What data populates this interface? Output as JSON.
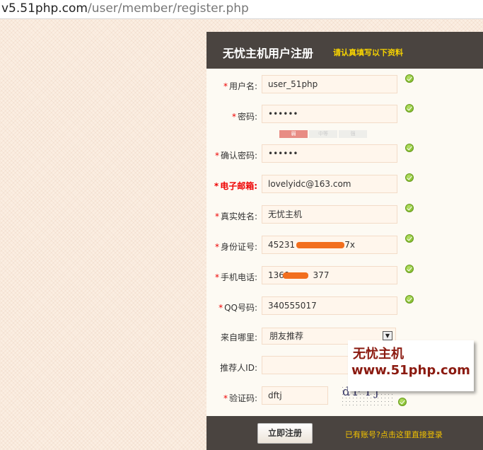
{
  "browser": {
    "url_host": "v5.51php.com",
    "url_path": "/user/member/register.php"
  },
  "header": {
    "title": "无忧主机用户注册",
    "subtitle": "请认真填写以下资料"
  },
  "form": {
    "username": {
      "label": "用户名:",
      "value": "user_51php"
    },
    "password": {
      "label": "密码:",
      "value": "••••••"
    },
    "strength": {
      "weak": "弱",
      "medium": "中等",
      "strong": "强"
    },
    "confirm": {
      "label": "确认密码:",
      "value": "••••••"
    },
    "email": {
      "label": "电子邮箱:",
      "value": "lovelyidc@163.com"
    },
    "realname": {
      "label": "真实姓名:",
      "value": "无忧主机"
    },
    "idcard": {
      "label": "身份证号:",
      "value_start": "45231",
      "value_end": "7x"
    },
    "mobile": {
      "label": "手机电话:",
      "value_start": "1369",
      "value_end": "377"
    },
    "qq": {
      "label": "QQ号码:",
      "value": "340555017"
    },
    "source": {
      "label": "来自哪里:",
      "value": "朋友推荐"
    },
    "referrer": {
      "label": "推荐人ID:",
      "value": ""
    },
    "captcha": {
      "label": "验证码:",
      "value": "dftj",
      "image_text": "dFTj"
    }
  },
  "footer": {
    "submit": "立即注册",
    "login_link": "已有账号?点击这里直接登录"
  },
  "watermark": {
    "line1": "无忧主机",
    "line2": "www.51php.com"
  },
  "colors": {
    "header_bg": "#4a4440",
    "accent_yellow": "#f7d300",
    "required_red": "#e00000",
    "ok_green": "#73b01b"
  }
}
